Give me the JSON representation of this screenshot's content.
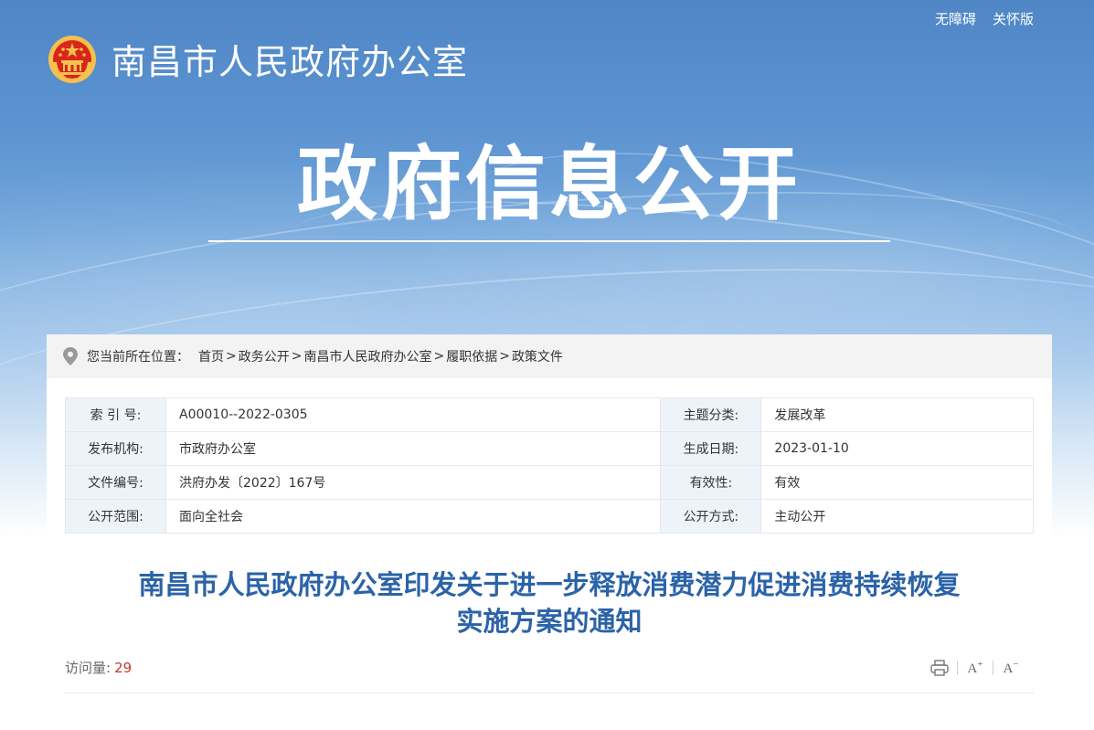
{
  "topbar": {
    "accessibility": "无障碍",
    "elderly": "关怀版"
  },
  "site": {
    "name": "南昌市人民政府办公室"
  },
  "hero": {
    "title": "政府信息公开"
  },
  "breadcrumb": {
    "label": "您当前所在位置：",
    "items": [
      "首页",
      "政务公开",
      "南昌市人民政府办公室",
      "履职依据",
      "政策文件"
    ],
    "separator": ">"
  },
  "meta": {
    "rows": [
      {
        "k1": "索 引 号:",
        "v1": "A00010--2022-0305",
        "k2": "主题分类:",
        "v2": "发展改革"
      },
      {
        "k1": "发布机构:",
        "v1": "市政府办公室",
        "k2": "生成日期:",
        "v2": "2023-01-10"
      },
      {
        "k1": "文件编号:",
        "v1": "洪府办发〔2022〕167号",
        "k2": "有效性:",
        "v2": "有效"
      },
      {
        "k1": "公开范围:",
        "v1": "面向全社会",
        "k2": "公开方式:",
        "v2": "主动公开"
      }
    ]
  },
  "document": {
    "title_line1": "南昌市人民政府办公室印发关于进一步释放消费潜力促进消费持续恢复",
    "title_line2": "实施方案的通知",
    "visits_label": "访问量:",
    "visits_count": "29"
  },
  "tools": {
    "print_icon": "print-icon",
    "font_up": "A",
    "font_down": "A"
  },
  "colors": {
    "title_blue": "#2b63a8",
    "visits_red": "#c0392b",
    "banner_blue": "#4f86c6"
  }
}
